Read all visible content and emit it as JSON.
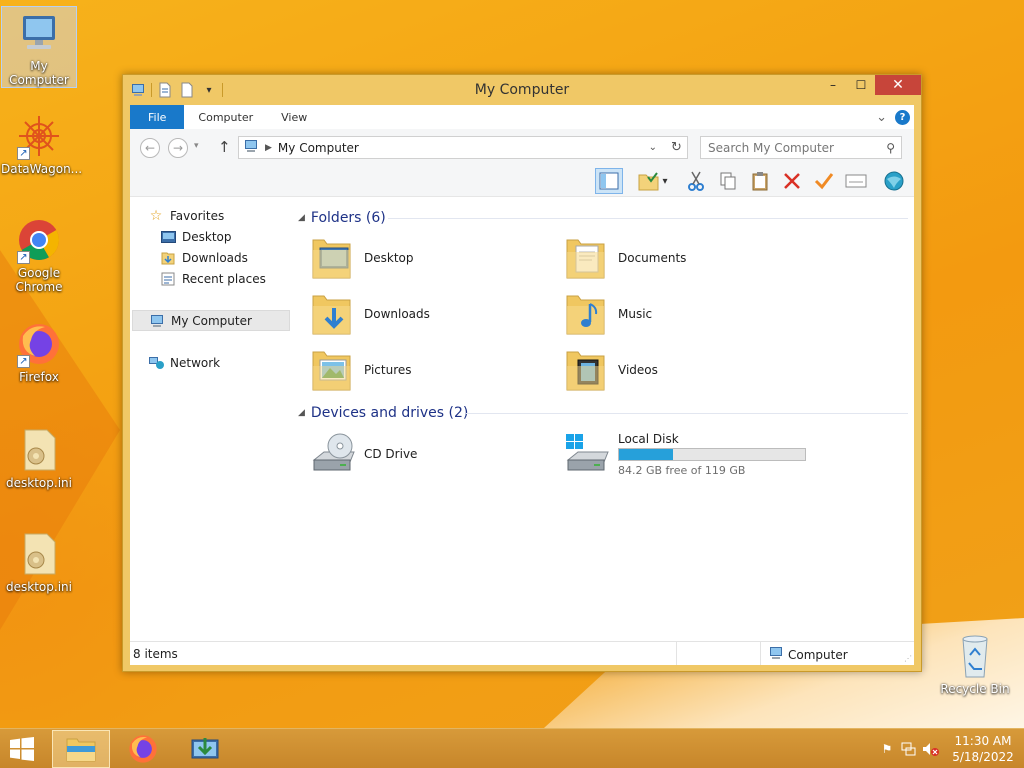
{
  "desktop": {
    "icons": [
      {
        "label": "My Computer"
      },
      {
        "label": "DataWagon..."
      },
      {
        "label": "Google Chrome"
      },
      {
        "label": "Firefox"
      },
      {
        "label": "desktop.ini"
      },
      {
        "label": "desktop.ini"
      },
      {
        "label": "Recycle Bin"
      }
    ]
  },
  "window": {
    "title": "My Computer",
    "close_glyph": "✕",
    "max_glyph": "☐",
    "min_glyph": "–",
    "ribbon_tabs": [
      "File",
      "Computer",
      "View"
    ],
    "help_glyph": "?",
    "expand_glyph": "⌄"
  },
  "address": {
    "path": "My Computer",
    "search_placeholder": "Search My Computer"
  },
  "navpane": {
    "favorites": "Favorites",
    "desktop": "Desktop",
    "downloads": "Downloads",
    "recent": "Recent places",
    "mycomputer": "My Computer",
    "network": "Network"
  },
  "folders": {
    "heading": "Folders (6)",
    "items": [
      "Desktop",
      "Documents",
      "Downloads",
      "Music",
      "Pictures",
      "Videos"
    ]
  },
  "devices": {
    "heading": "Devices and drives (2)",
    "cd": "CD Drive",
    "disk": {
      "name": "Local Disk",
      "free_text": "84.2 GB free of 119 GB",
      "used_fraction": 0.292
    }
  },
  "status": {
    "items": "8 items",
    "location": "Computer"
  },
  "taskbar": {
    "time": "11:30 AM",
    "date": "5/18/2022"
  },
  "colors": {
    "accent": "#1979ca",
    "close": "#c7453a",
    "drive_fill": "#26a0da",
    "wallpaper": "#f4a313"
  }
}
